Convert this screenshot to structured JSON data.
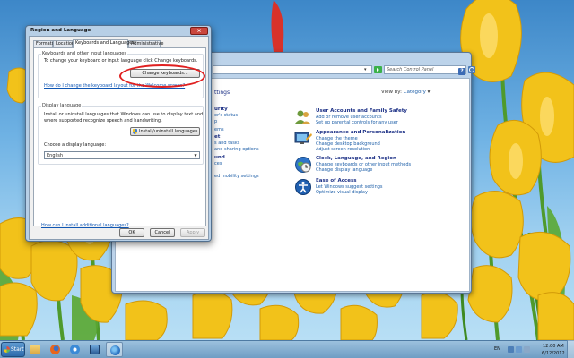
{
  "dialog": {
    "title": "Region and Language",
    "tabs": [
      "Formats",
      "Location",
      "Keyboards and Languages",
      "Administrative"
    ],
    "active_tab": "Keyboards and Languages",
    "keyboards_group": {
      "legend": "Keyboards and other input languages",
      "text": "To change your keyboard or input language click Change keyboards.",
      "change_button": "Change keyboards...",
      "link": "How do I change the keyboard layout for the Welcome screen?"
    },
    "display_group": {
      "legend": "Display language",
      "text_line1": "Install or uninstall languages that Windows can use to display text and",
      "text_line2": "where supported recognize speech and handwriting.",
      "install_button": "Install/uninstall languages...",
      "choose_label": "Choose a display language:",
      "selected_language": "English"
    },
    "install_link": "How can I install additional languages?",
    "buttons": {
      "ok": "OK",
      "cancel": "Cancel",
      "apply": "Apply"
    },
    "close_glyph": "×"
  },
  "control_panel": {
    "search_placeholder": "Search Control Panel",
    "help_glyph": "?",
    "heading_fragment": "ttings",
    "view_by_label": "View by:",
    "view_by_value": "Category",
    "left_fragments": [
      {
        "text": "urity",
        "head": true
      },
      {
        "text": "er's status",
        "head": false
      },
      {
        "text": "p",
        "head": false
      },
      {
        "text": "ems",
        "head": false
      },
      {
        "text": "et",
        "head": true
      },
      {
        "text": "s and tasks",
        "head": false
      },
      {
        "text": "and sharing options",
        "head": false
      },
      {
        "text": "und",
        "head": true
      },
      {
        "text": "ces",
        "head": false
      },
      {
        "text": "",
        "head": false
      },
      {
        "text": "ed mobility settings",
        "head": false
      }
    ],
    "categories": [
      {
        "title": "User Accounts and Family Safety",
        "icon": "users-icon",
        "links": [
          "Add or remove user accounts",
          "Set up parental controls for any user"
        ]
      },
      {
        "title": "Appearance and Personalization",
        "icon": "appearance-icon",
        "links": [
          "Change the theme",
          "Change desktop background",
          "Adjust screen resolution"
        ]
      },
      {
        "title": "Clock, Language, and Region",
        "icon": "clock-globe-icon",
        "links": [
          "Change keyboards or other input methods",
          "Change display language"
        ]
      },
      {
        "title": "Ease of Access",
        "icon": "ease-of-access-icon",
        "links": [
          "Let Windows suggest settings",
          "Optimize visual display"
        ]
      }
    ]
  },
  "taskbar": {
    "start_label": "Start",
    "pinned": [
      "explorer-icon",
      "firefox-icon",
      "internet-explorer-icon",
      "remote-desktop-icon",
      "control-panel-icon"
    ],
    "active_app": "control-panel-icon",
    "language": "EN",
    "time": "12:00 AM",
    "date": "6/12/2012"
  },
  "colors": {
    "link_blue": "#1e5fa8",
    "heading_blue": "#1e3287",
    "annotation_red": "#e02020",
    "wallpaper_yellow": "#f2c21a"
  }
}
